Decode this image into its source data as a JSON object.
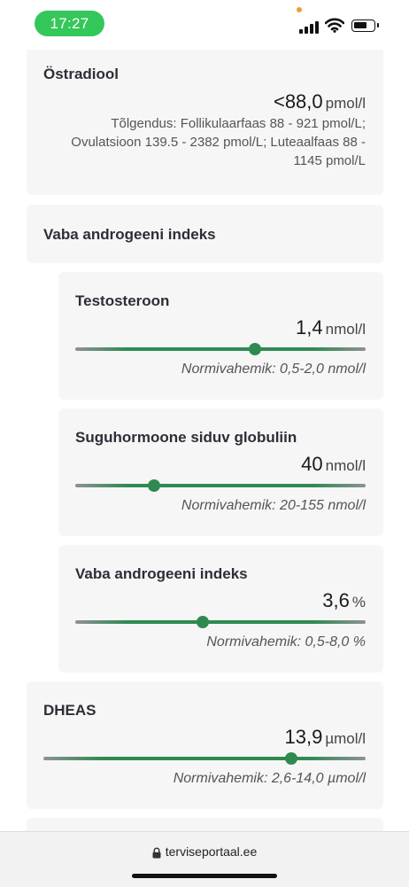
{
  "status": {
    "time": "17:27"
  },
  "cards": {
    "ostradiool": {
      "title": "Östradiool",
      "value": "<88,0",
      "unit": "pmol/l",
      "interpretation": "Tõlgendus: Follikulaarfaas 88 - 921 pmol/L; Ovulatsioon 139.5 - 2382 pmol/L; Luteaalfaas 88 - 1145 pmol/L"
    },
    "vaba_group": {
      "title": "Vaba androgeeni indeks"
    },
    "testosteroon": {
      "title": "Testosteroon",
      "value": "1,4",
      "unit": "nmol/l",
      "range": "Normivahemik: 0,5-2,0 nmol/l",
      "level": 0.62
    },
    "shbg": {
      "title": "Suguhormoone siduv globuliin",
      "value": "40",
      "unit": "nmol/l",
      "range": "Normivahemik: 20-155 nmol/l",
      "level": 0.27
    },
    "vai": {
      "title": "Vaba androgeeni indeks",
      "value": "3,6",
      "unit": "%",
      "range": "Normivahemik: 0,5-8,0 %",
      "level": 0.44
    },
    "dheas": {
      "title": "DHEAS",
      "value": "13,9",
      "unit": "µmol/l",
      "range": "Normivahemik: 2,6-14,0 µmol/l",
      "level": 0.77
    }
  },
  "browser": {
    "url": "terviseportaal.ee"
  },
  "colors": {
    "in_range": "#2f8a51",
    "out_range": "#8f9097",
    "time_pill": "#34c759"
  }
}
